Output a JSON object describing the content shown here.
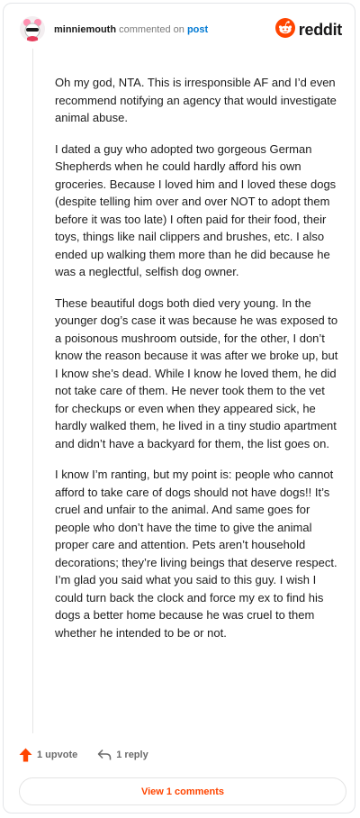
{
  "header": {
    "username": "minniemouth",
    "action_text": "commented on",
    "post_link": "post",
    "brand_name": "reddit"
  },
  "comment": {
    "paragraphs": [
      "Oh my god, NTA. This is irresponsible AF and I’d even recommend notifying an agency that would investigate animal abuse.",
      "I dated a guy who adopted two gorgeous German Shepherds when he could hardly afford his own groceries. Because I loved him and I loved these dogs (despite telling him over and over NOT to adopt them before it was too late) I often paid for their food, their toys, things like nail clippers and brushes, etc. I also ended up walking them more than he did because he was a neglectful, selfish dog owner.",
      "These beautiful dogs both died very young. In the younger dog’s case it was because he was exposed to a poisonous mushroom outside, for the other, I don’t know the reason because it was after we broke up, but I know she’s dead. While I know he loved them, he did not take care of them. He never took them to the vet for checkups or even when they appeared sick, he hardly walked them, he lived in a tiny studio apartment and didn’t have a backyard for them, the list goes on.",
      "I know I’m ranting, but my point is: people who cannot afford to take care of dogs should not have dogs!! It’s cruel and unfair to the animal. And same goes for people who don’t have the time to give the animal proper care and attention. Pets aren’t household decorations; they’re living beings that deserve respect. I’m glad you said what you said to this guy. I wish I could turn back the clock and force my ex to find his dogs a better home because he was cruel to them whether he intended to be or not."
    ]
  },
  "actions": {
    "upvote_label": "1 upvote",
    "reply_label": "1 reply",
    "view_comments_label": "View 1 comments"
  },
  "colors": {
    "accent": "#ff4500",
    "link": "#0079d3"
  },
  "icons": {
    "avatar": "avatar-icon",
    "brand": "reddit-logo-icon",
    "upvote": "upvote-arrow-icon",
    "reply": "reply-arrow-icon"
  }
}
